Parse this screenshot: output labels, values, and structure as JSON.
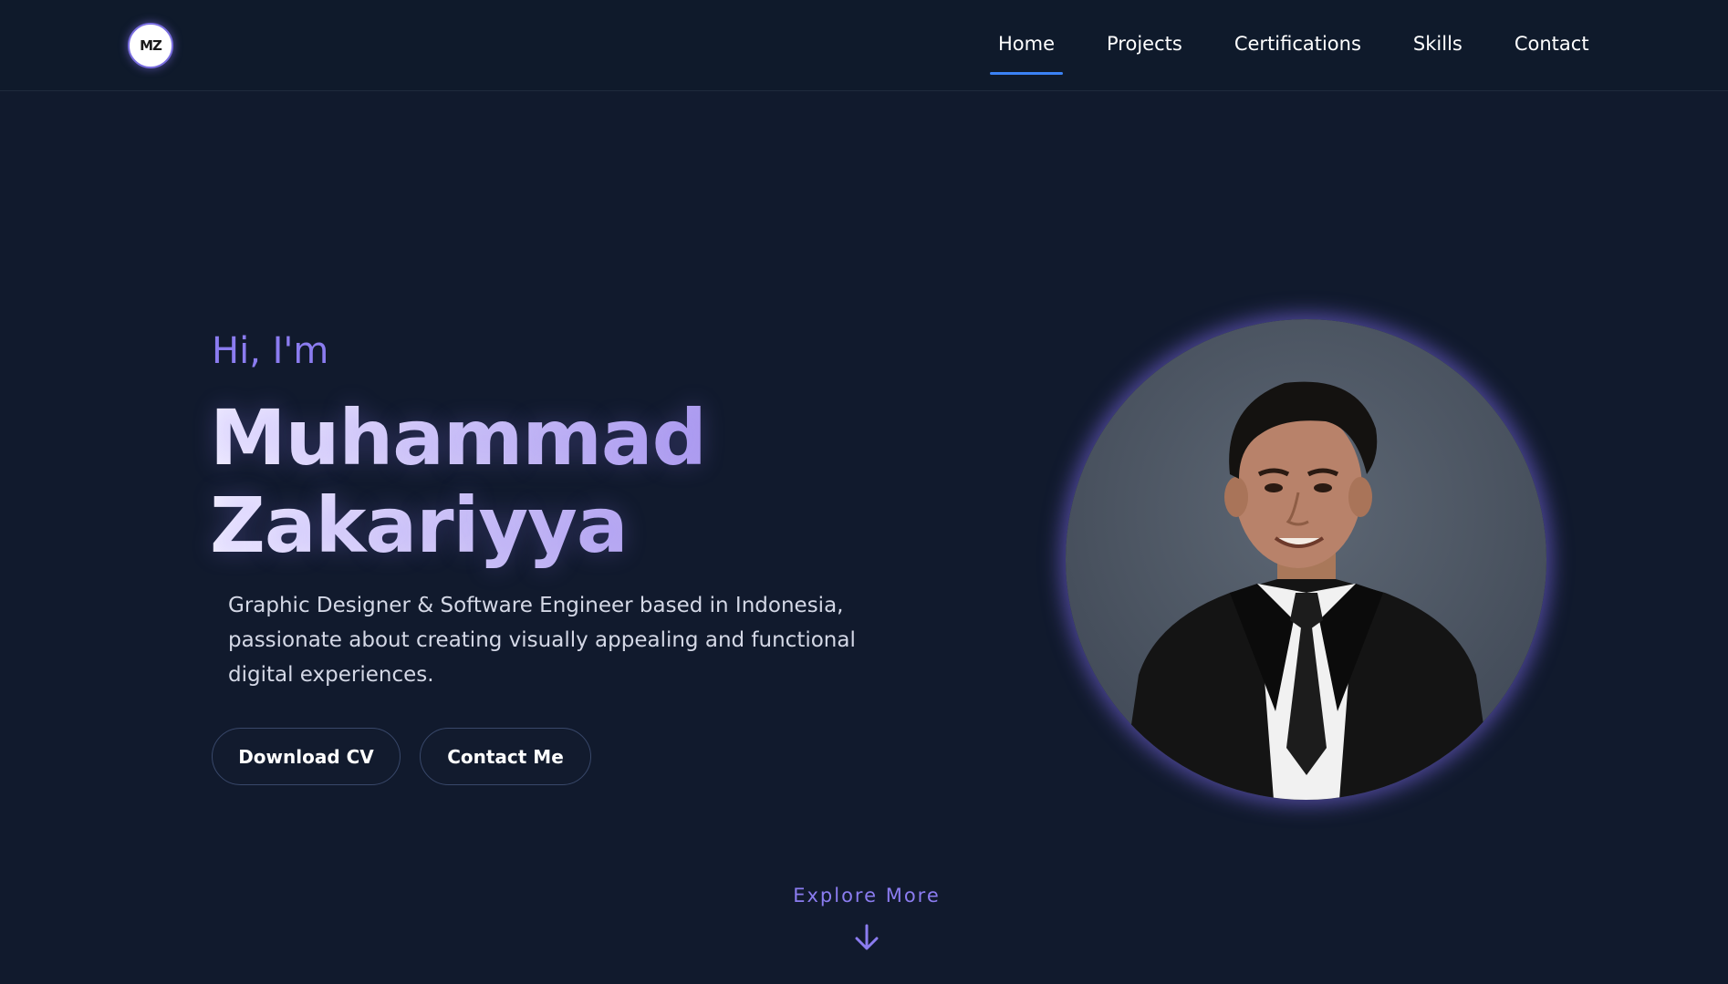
{
  "nav": {
    "logo_text": "MZ",
    "links": [
      {
        "label": "Home",
        "active": true
      },
      {
        "label": "Projects",
        "active": false
      },
      {
        "label": "Certifications",
        "active": false
      },
      {
        "label": "Skills",
        "active": false
      },
      {
        "label": "Contact",
        "active": false
      }
    ],
    "active_indicator_color": "#3b82f6"
  },
  "hero": {
    "greeting": "Hi, I'm",
    "name_line1": "Muhammad",
    "name_line2": "Zakariyya",
    "description": "Graphic Designer & Software Engineer based in Indonesia, passionate about creating visually appealing and functional digital experiences.",
    "buttons": {
      "download_cv": "Download CV",
      "contact_me": "Contact Me"
    }
  },
  "explore": {
    "label": "Explore More",
    "icon": "arrow-down-icon"
  },
  "colors": {
    "background": "#111a2d",
    "accent": "#8b7cf0",
    "button_border": "#39486a"
  }
}
